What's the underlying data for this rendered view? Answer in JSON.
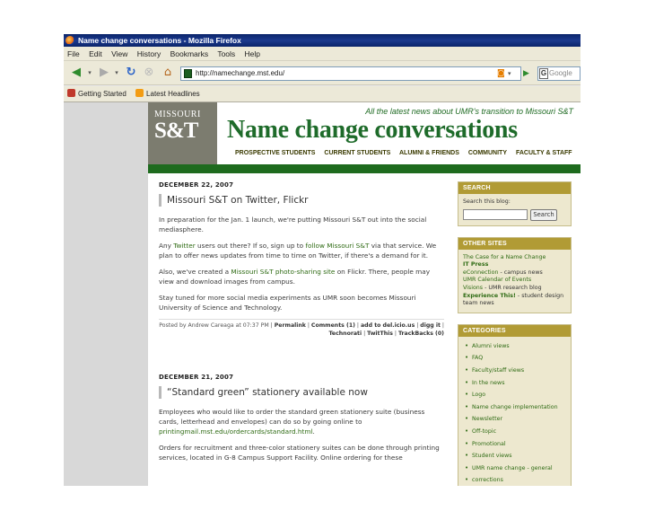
{
  "window": {
    "title": "Name change conversations - Mozilla Firefox"
  },
  "menu": [
    "File",
    "Edit",
    "View",
    "History",
    "Bookmarks",
    "Tools",
    "Help"
  ],
  "nav": {
    "url": "http://namechange.mst.edu/",
    "search_placeholder": "Google"
  },
  "bookmarks": [
    {
      "label": "Getting Started",
      "icon": "firefox-icon"
    },
    {
      "label": "Latest Headlines",
      "icon": "rss-icon"
    }
  ],
  "header": {
    "logo_top": "MISSOURI",
    "logo_bottom": "S&T",
    "tagline": "All the latest news about UMR's transition to Missouri S&T",
    "title": "Name change conversations",
    "nav": [
      "PROSPECTIVE STUDENTS",
      "CURRENT STUDENTS",
      "ALUMNI & FRIENDS",
      "COMMUNITY",
      "FACULTY & STAFF"
    ]
  },
  "posts": [
    {
      "date": "DECEMBER 22, 2007",
      "title": "Missouri S&T on Twitter, Flickr",
      "p1": "In preparation for the Jan. 1 launch, we're putting Missouri S&T out into the social mediasphere.",
      "p2a": "Any ",
      "p2link1": "Twitter",
      "p2b": " users out there? If so, sign up to ",
      "p2link2": "follow Missouri S&T",
      "p2c": " via that service. We plan to offer news updates from time to time on Twitter, if there's a demand for it.",
      "p3a": "Also, we've created a ",
      "p3link": "Missouri S&T photo-sharing site",
      "p3b": " on Flickr. There, people may view and download images from campus.",
      "p4": "Stay tuned for more social media experiments as UMR soon becomes Missouri University of Science and Technology.",
      "footer_posted": "Posted by Andrew Careaga at 07:37 PM",
      "footer_links1": [
        "Permalink",
        "Comments (1)",
        "add to del.icio.us",
        "digg it"
      ],
      "footer_links2": [
        "Technorati",
        "TwitThis",
        "TrackBacks (0)"
      ]
    },
    {
      "date": "DECEMBER 21, 2007",
      "title": "“Standard green” stationery available now",
      "p1a": "Employees who would like to order the standard green stationery suite (business cards, letterhead and envelopes) can do so by going online to ",
      "p1link": "printingmail.mst.edu/ordercards/standard.html",
      "p1b": ".",
      "p2": "Orders for recruitment and three-color stationery suites can be done through printing services, located in G-8 Campus Support Facility. Online ordering for these"
    }
  ],
  "sidebar": {
    "search": {
      "head": "SEARCH",
      "label": "Search this blog:",
      "button": "Search"
    },
    "other_sites": {
      "head": "OTHER SITES",
      "items": [
        {
          "link": "The Case for a Name Change",
          "rest": ""
        },
        {
          "link": "IT Press",
          "rest": ""
        },
        {
          "link": "eConnection",
          "rest": " - campus news"
        },
        {
          "link": "UMR Calendar of Events",
          "rest": ""
        },
        {
          "link": "Visions",
          "rest": " - UMR research blog"
        },
        {
          "link": "Experience This!",
          "rest": " - student design"
        },
        {
          "link": "",
          "rest": "team news"
        }
      ]
    },
    "categories": {
      "head": "CATEGORIES",
      "items": [
        "Alumni views",
        "FAQ",
        "Faculty/staff views",
        "In the news",
        "Logo",
        "Name change implementation",
        "Newsletter",
        "Off-topic",
        "Promotional",
        "Student views",
        "UMR name change - general",
        "corrections"
      ]
    }
  }
}
